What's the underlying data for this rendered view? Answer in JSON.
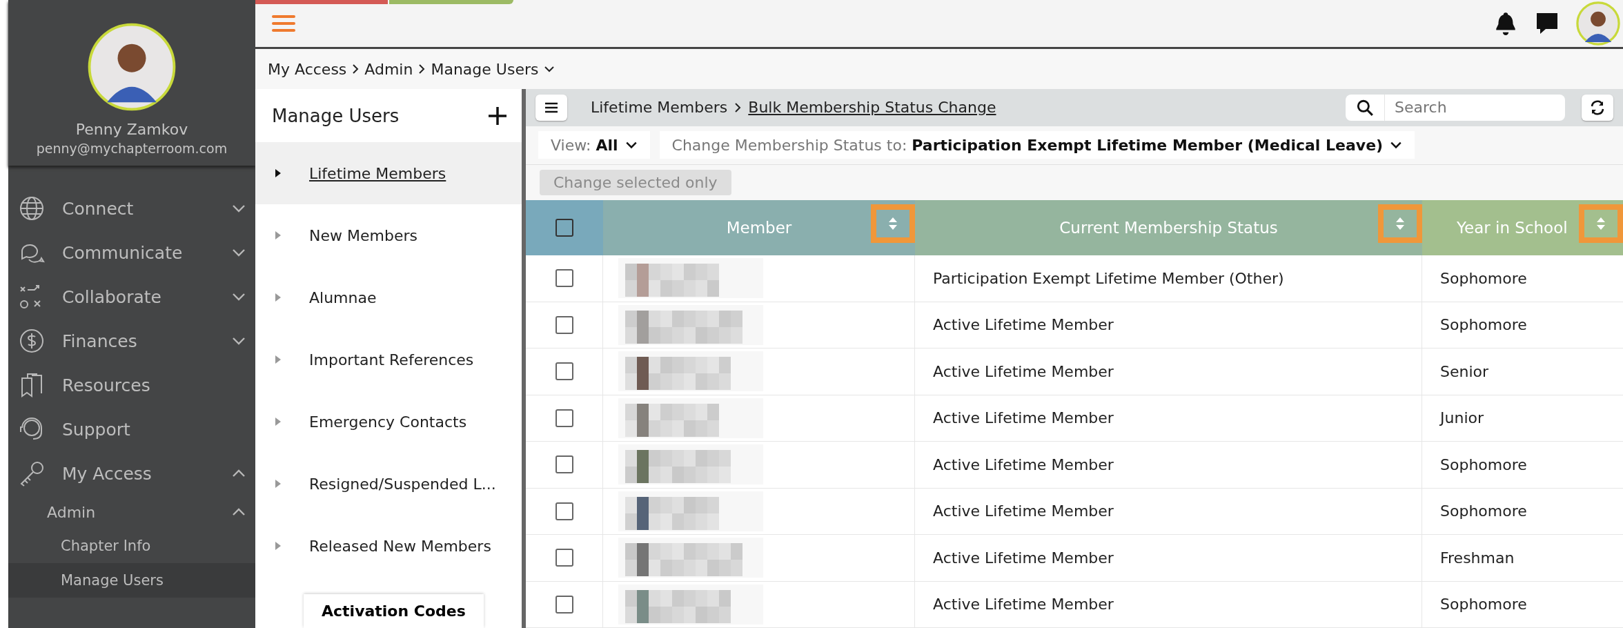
{
  "profile": {
    "name": "Penny Zamkov",
    "email": "penny@mychapterroom.com"
  },
  "nav": [
    {
      "label": "Connect",
      "expanded": false
    },
    {
      "label": "Communicate",
      "expanded": false
    },
    {
      "label": "Collaborate",
      "expanded": false
    },
    {
      "label": "Finances",
      "expanded": false
    },
    {
      "label": "Resources"
    },
    {
      "label": "Support"
    },
    {
      "label": "My Access",
      "expanded": true,
      "children": [
        {
          "label": "Admin",
          "expanded": true,
          "children": [
            {
              "label": "Chapter Info",
              "selected": false
            },
            {
              "label": "Manage Users",
              "selected": true
            }
          ]
        }
      ]
    }
  ],
  "breadcrumb": [
    "My Access",
    "Admin",
    "Manage Users"
  ],
  "left_panel": {
    "title": "Manage Users",
    "items": [
      {
        "label": "Lifetime Members",
        "selected": true
      },
      {
        "label": "New Members",
        "selected": false
      },
      {
        "label": "Alumnae",
        "selected": false
      },
      {
        "label": "Important References",
        "selected": false
      },
      {
        "label": "Emergency Contacts",
        "selected": false
      },
      {
        "label": "Resigned/Suspended L...",
        "selected": false
      },
      {
        "label": "Released New Members",
        "selected": false
      }
    ],
    "button": "Activation Codes"
  },
  "toolbar": {
    "path": [
      "Lifetime Members",
      "Bulk Membership Status Change"
    ],
    "search": {
      "placeholder": "Search"
    }
  },
  "filters": {
    "view_label": "View:",
    "view_value": "All",
    "status_label": "Change Membership Status to:",
    "status_value": "Participation Exempt Lifetime Member (Medical Leave)"
  },
  "change_button": {
    "label": "Change selected only",
    "disabled": true
  },
  "table": {
    "select_all": {
      "checked": false
    },
    "columns": [
      {
        "label": "Member",
        "highlighted": true
      },
      {
        "label": "Current Membership Status",
        "highlighted": true
      },
      {
        "label": "Year in School",
        "highlighted": true
      }
    ],
    "rows": [
      {
        "checked": false,
        "status": "Participation Exempt Lifetime Member (Other)",
        "year": "Sophomore"
      },
      {
        "checked": false,
        "status": "Active Lifetime Member",
        "year": "Sophomore"
      },
      {
        "checked": false,
        "status": "Active Lifetime Member",
        "year": "Senior"
      },
      {
        "checked": false,
        "status": "Active Lifetime Member",
        "year": "Junior"
      },
      {
        "checked": false,
        "status": "Active Lifetime Member",
        "year": "Sophomore"
      },
      {
        "checked": false,
        "status": "Active Lifetime Member",
        "year": "Sophomore"
      },
      {
        "checked": false,
        "status": "Active Lifetime Member",
        "year": "Freshman"
      },
      {
        "checked": false,
        "status": "Active Lifetime Member",
        "year": "Sophomore"
      }
    ]
  }
}
